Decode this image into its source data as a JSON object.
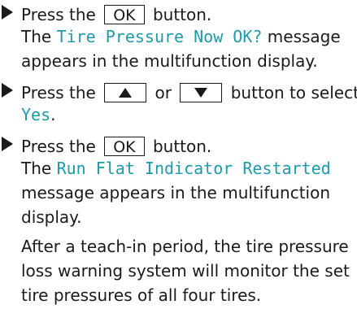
{
  "colors": {
    "text": "#1a1a1a",
    "message": "#1f9aa8"
  },
  "steps": [
    {
      "press": "Press the",
      "key": "OK",
      "after": "button.",
      "result_prefix": "The",
      "message": "Tire Pressure Now OK?",
      "result_suffix": "message",
      "result_line2": "appears in the multifunction display."
    },
    {
      "press": "Press the",
      "key_up": "up-arrow-icon",
      "or": "or",
      "key_down": "down-arrow-icon",
      "after": "button to select",
      "select_value": "Yes",
      "select_suffix": "."
    },
    {
      "press": "Press the",
      "key": "OK",
      "after": "button.",
      "result_prefix": "The",
      "message": "Run Flat Indicator Restarted",
      "result_line2": "message appears in the multifunction",
      "result_line3": "display."
    }
  ],
  "note": {
    "line1": "After a teach-in period, the tire pressure",
    "line2": "loss warning system will monitor the set",
    "line3": "tire pressures of all four tires."
  }
}
